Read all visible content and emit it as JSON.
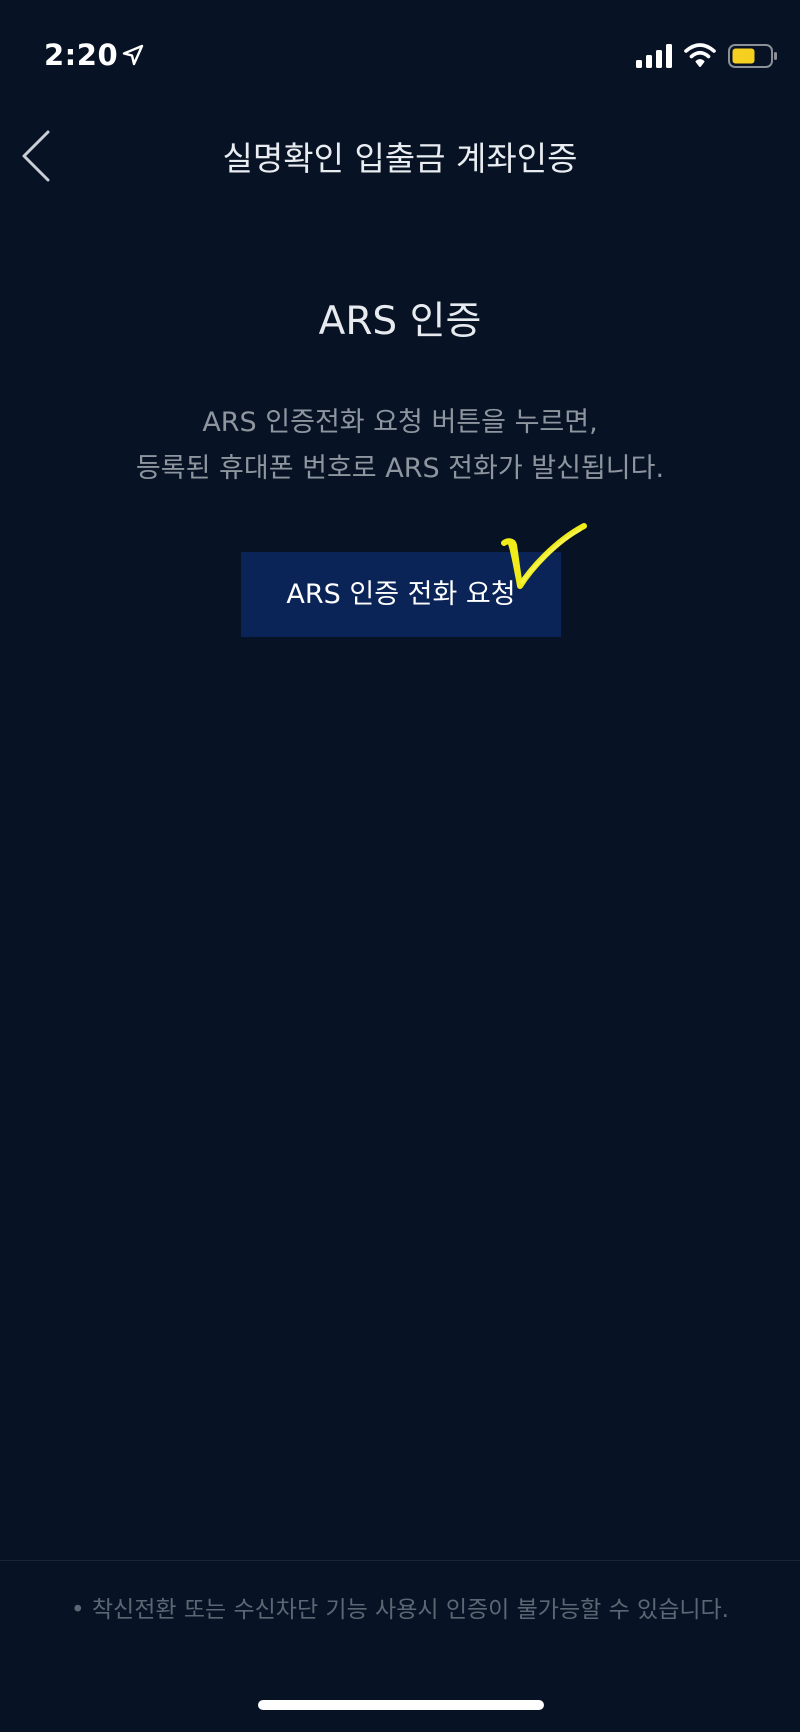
{
  "status_bar": {
    "time": "2:20",
    "icons": [
      "location-arrow-icon",
      "cellular-signal-icon",
      "wifi-icon",
      "battery-icon"
    ],
    "battery_color": "#f5d020"
  },
  "header": {
    "back_icon": "chevron-left-icon",
    "title": "실명확인 입출금 계좌인증"
  },
  "main": {
    "title": "ARS 인증",
    "description_lines": [
      "ARS 인증전화 요청 버튼을 누르면,",
      "등록된 휴대폰 번호로 ARS 전화가 발신됩니다."
    ],
    "request_button_label": "ARS 인증 전화 요청",
    "annotation_icon": "yellow-checkmark-icon",
    "annotation_color": "#f0ec1a"
  },
  "footer": {
    "note": "• 착신전환 또는 수신차단 기능 사용시 인증이 불가능할 수 있습니다."
  },
  "colors": {
    "background": "#071324",
    "button": "#0b2457",
    "description_text": "#8e959f",
    "footer_text": "#5d6673"
  }
}
